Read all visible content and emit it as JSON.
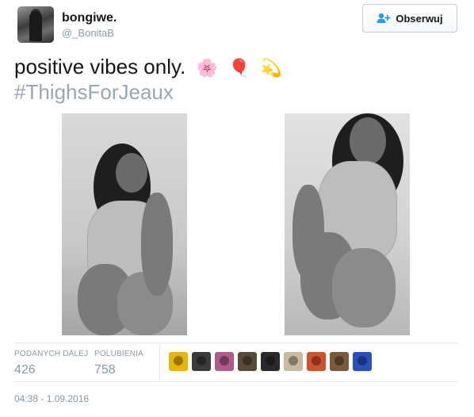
{
  "user": {
    "display_name": "bongiwe.",
    "handle": "@_BonitaB"
  },
  "follow_button": {
    "label": "Obserwuj",
    "icon": "follow-user-icon"
  },
  "tweet": {
    "text": "positive vibes only.",
    "emojis": [
      "🌸",
      "🎈",
      "💫"
    ],
    "hashtag": "#ThighsForJeaux"
  },
  "stats": {
    "retweets_label": "PODANYCH DALEJ",
    "retweets_value": "426",
    "likes_label": "POLUBIENIA",
    "likes_value": "758"
  },
  "likers": [
    {
      "color": "#e8b400"
    },
    {
      "color": "#3a3a3a"
    },
    {
      "color": "#b05a8a"
    },
    {
      "color": "#5a4a3a"
    },
    {
      "color": "#2a2a2a"
    },
    {
      "color": "#c9b9a0"
    },
    {
      "color": "#d2502a"
    },
    {
      "color": "#7a5a3a"
    },
    {
      "color": "#2a4fbf"
    }
  ],
  "timestamp": "04:38 - 1.09.2016",
  "colors": {
    "text_primary": "#14171a",
    "text_muted": "#8899a6",
    "hashtag": "#9aa6b1",
    "border": "#e1e8ed"
  }
}
